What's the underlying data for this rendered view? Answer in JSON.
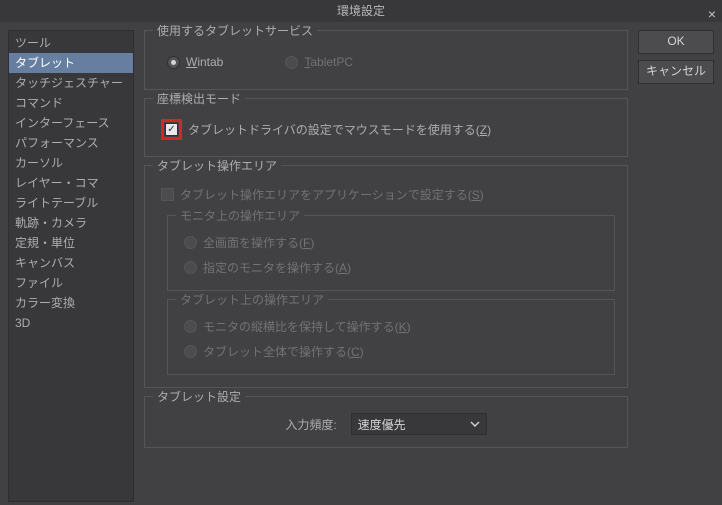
{
  "title": "環境設定",
  "buttons": {
    "ok": "OK",
    "cancel": "キャンセル"
  },
  "sidebar": {
    "items": [
      {
        "label": "ツール"
      },
      {
        "label": "タブレット"
      },
      {
        "label": "タッチジェスチャー"
      },
      {
        "label": "コマンド"
      },
      {
        "label": "インターフェース"
      },
      {
        "label": "パフォーマンス"
      },
      {
        "label": "カーソル"
      },
      {
        "label": "レイヤー・コマ"
      },
      {
        "label": "ライトテーブル"
      },
      {
        "label": "軌跡・カメラ"
      },
      {
        "label": "定規・単位"
      },
      {
        "label": "キャンバス"
      },
      {
        "label": "ファイル"
      },
      {
        "label": "カラー変換"
      },
      {
        "label": "3D"
      }
    ],
    "active_index": 1
  },
  "service": {
    "legend": "使用するタブレットサービス",
    "options": {
      "wintab": {
        "prefix": "W",
        "rest": "intab"
      },
      "tabletpc": {
        "prefix": "T",
        "rest": "abletPC"
      }
    },
    "selected": "wintab"
  },
  "coord": {
    "legend": "座標検出モード",
    "mouse_mode": {
      "text": "タブレットドライバの設定でマウスモードを使用する(",
      "accel": "Z",
      "suffix": ")"
    }
  },
  "area": {
    "legend": "タブレット操作エリア",
    "app_set": {
      "text": "タブレット操作エリアをアプリケーションで設定する(",
      "accel": "S",
      "suffix": ")"
    },
    "monitor": {
      "legend": "モニタ上の操作エリア",
      "full": {
        "text": "全画面を操作する(",
        "accel": "F",
        "suffix": ")"
      },
      "spec": {
        "text": "指定のモニタを操作する(",
        "accel": "A",
        "suffix": ")"
      }
    },
    "tablet": {
      "legend": "タブレット上の操作エリア",
      "keep": {
        "text": "モニタの縦横比を保持して操作する(",
        "accel": "K",
        "suffix": ")"
      },
      "whole": {
        "text": "タブレット全体で操作する(",
        "accel": "C",
        "suffix": ")"
      }
    }
  },
  "settings": {
    "legend": "タブレット設定",
    "freq_label": "入力頻度:",
    "freq_value": "速度優先"
  }
}
